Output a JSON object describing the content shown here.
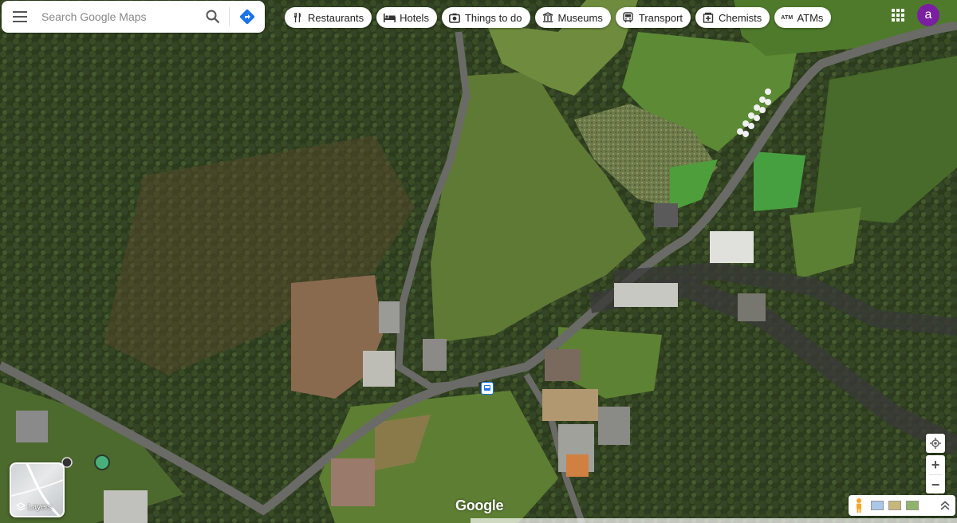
{
  "search": {
    "placeholder": "Search Google Maps",
    "menu_icon": "menu-icon",
    "search_icon": "search-icon",
    "directions_icon": "directions-icon"
  },
  "chips": [
    {
      "label": "Restaurants",
      "icon": "fork-knife-icon"
    },
    {
      "label": "Hotels",
      "icon": "bed-icon"
    },
    {
      "label": "Things to do",
      "icon": "camera-icon"
    },
    {
      "label": "Museums",
      "icon": "museum-icon"
    },
    {
      "label": "Transport",
      "icon": "train-icon"
    },
    {
      "label": "Chemists",
      "icon": "pharmacy-icon"
    },
    {
      "label": "ATMs",
      "icon": "atm-icon",
      "badge": "ATM"
    }
  ],
  "account": {
    "avatar_letter": "a",
    "avatar_color": "#7b1fa2"
  },
  "layers": {
    "label": "Layers"
  },
  "brand": {
    "logo_text": "Google"
  },
  "controls": {
    "zoom_in": "+",
    "zoom_out": "−"
  },
  "colors": {
    "road": "#4a4a4a",
    "field": "#5f7f33",
    "forest": "#2a3a1c",
    "accent": "#1a73e8"
  }
}
